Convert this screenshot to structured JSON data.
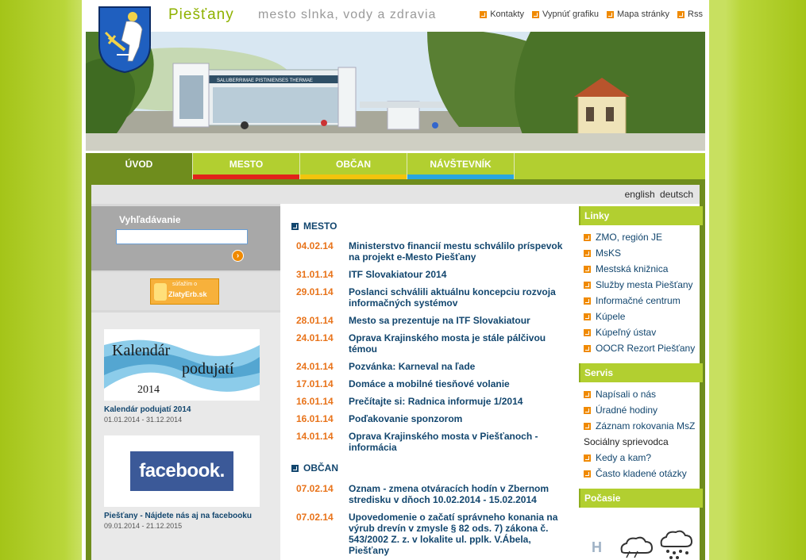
{
  "header": {
    "site_name": "Piešťany",
    "tagline": "mesto slnka, vody a zdravia",
    "links": [
      "Kontakty",
      "Vypnúť grafiku",
      "Mapa stránky",
      "Rss"
    ]
  },
  "banner": {
    "colonnade_sign": "SALUBERRIMAE PISTINIENSES THERMAE"
  },
  "nav": {
    "tabs": [
      {
        "label": "ÚVOD",
        "color": "#6f8d1d"
      },
      {
        "label": "MESTO",
        "color": "#e2231a"
      },
      {
        "label": "OBČAN",
        "color": "#f2c40d"
      },
      {
        "label": "NÁVŠTEVNÍK",
        "color": "#2aa6e0"
      }
    ]
  },
  "lang": [
    "english",
    "deutsch"
  ],
  "search": {
    "title": "Vyhľadávanie",
    "value": "",
    "go_icon": "arrow-right-icon"
  },
  "zlaty_erb": {
    "small": "súťažím o",
    "big": "ZlatyErb.sk"
  },
  "promos": [
    {
      "image_line1": "Kalendár",
      "image_line2": "podujatí",
      "image_line3": "2014",
      "title": "Kalendár podujatí 2014",
      "dates": "01.01.2014 - 31.12.2014"
    },
    {
      "image_text": "facebook.",
      "title": "Piešťany - Nájdete nás aj na facebooku",
      "dates": "09.01.2014 - 21.12.2015"
    }
  ],
  "news": {
    "mesto_title": "MESTO",
    "mesto": [
      {
        "date": "04.02.14",
        "title": "Ministerstvo financií mestu schválilo príspevok na projekt e-Mesto Piešťany"
      },
      {
        "date": "31.01.14",
        "title": "ITF Slovakiatour 2014"
      },
      {
        "date": "29.01.14",
        "title": "Poslanci schválili aktuálnu koncepciu rozvoja informačných systémov"
      },
      {
        "date": "28.01.14",
        "title": "Mesto sa prezentuje na ITF Slovakiatour"
      },
      {
        "date": "24.01.14",
        "title": "Oprava Krajinského mosta je stále pálčivou témou"
      },
      {
        "date": "24.01.14",
        "title": "Pozvánka: Karneval na ľade"
      },
      {
        "date": "17.01.14",
        "title": "Domáce a mobilné tiesňové volanie"
      },
      {
        "date": "16.01.14",
        "title": "Prečítajte si: Radnica informuje 1/2014"
      },
      {
        "date": "16.01.14",
        "title": "Poďakovanie sponzorom"
      },
      {
        "date": "14.01.14",
        "title": "Oprava Krajinského mosta v Piešťanoch - informácia"
      }
    ],
    "obcan_title": "OBČAN",
    "obcan": [
      {
        "date": "07.02.14",
        "title": "Oznam - zmena otváracích hodín v Zbernom stredisku v dňoch 10.02.2014 - 15.02.2014"
      },
      {
        "date": "07.02.14",
        "title": "Upovedomenie o začatí správneho konania na výrub drevín v zmysle § 82 ods. 7) zákona č. 543/2002 Z. z. v lokalite ul. pplk. V.Ábela, Piešťany"
      }
    ]
  },
  "right": {
    "linky_title": "Linky",
    "linky": [
      "ZMO, región JE",
      "MsKS",
      "Mestská knižnica",
      "Služby mesta Piešťany",
      "Informačné centrum",
      "Kúpele",
      "Kúpeľný ústav",
      "OOCR Rezort Piešťany"
    ],
    "servis_title": "Servis",
    "servis": [
      {
        "label": "Napísali o nás",
        "bullet": true
      },
      {
        "label": "Úradné hodiny",
        "bullet": true
      },
      {
        "label": "Záznam rokovania MsZ",
        "bullet": true
      },
      {
        "label": "Sociálny sprievodca",
        "bullet": false
      },
      {
        "label": "Kedy a kam?",
        "bullet": true
      },
      {
        "label": "Často kladené otázky",
        "bullet": true
      }
    ],
    "pocasie_title": "Počasie",
    "weather_letter": "H",
    "weather_icons": [
      "cloud-icon",
      "rain-cloud-icon"
    ]
  }
}
